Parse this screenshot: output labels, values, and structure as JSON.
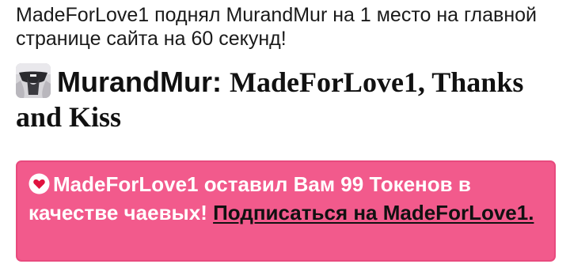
{
  "notice": {
    "text": "MadeForLove1 поднял MurandMur на 1 место на главной странице сайта на 60 секунд!"
  },
  "message": {
    "username": "MurandMur:",
    "text": "MadeForLove1, Thanks and Kiss",
    "avatar_icon": "user-photo-avatar"
  },
  "tip": {
    "icon": "heart-icon",
    "text": "MadeForLove1 оставил Вам 99 Токенов в качестве чаевых!",
    "link_label": "Подписаться на MadeForLove1.",
    "colors": {
      "background": "#f25a8c",
      "text": "#ffffff",
      "link": "#111111"
    }
  }
}
